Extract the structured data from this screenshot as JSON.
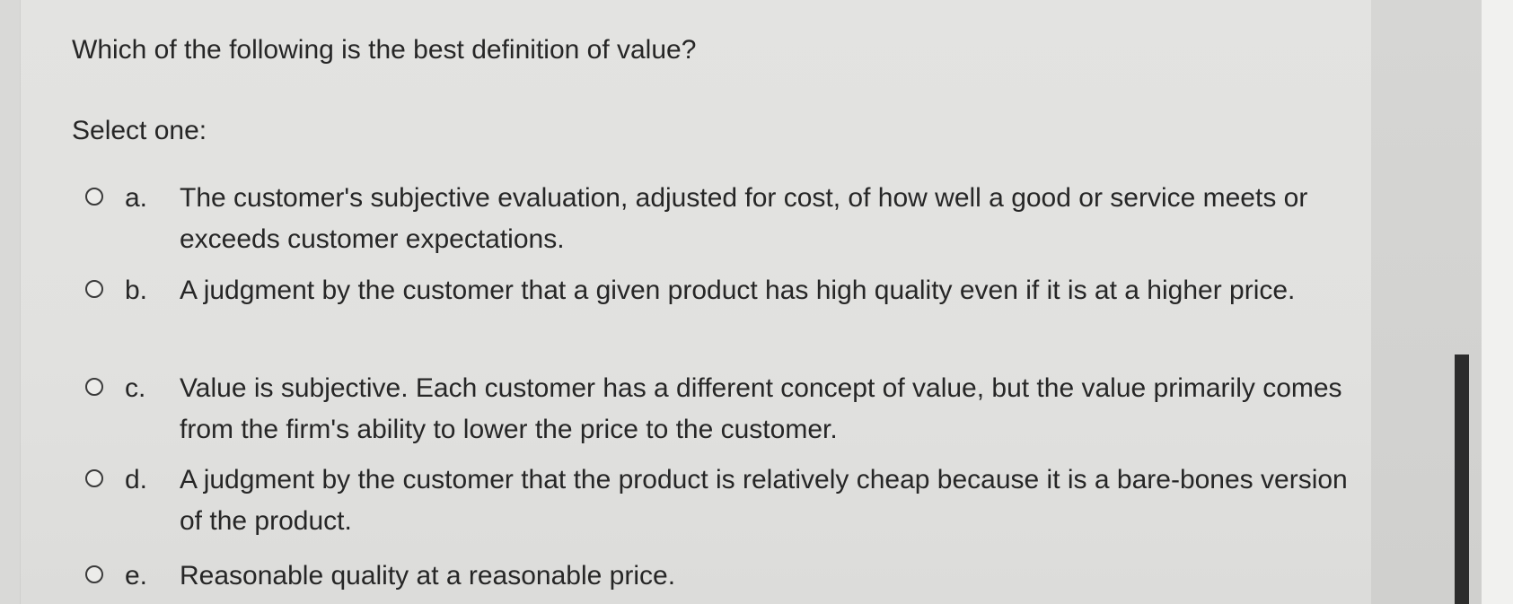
{
  "question": {
    "prompt": "Which of the following is the best definition of value?",
    "instruction": "Select one:"
  },
  "options": [
    {
      "letter": "a.",
      "text": "The customer's subjective evaluation, adjusted for cost, of how well a good or service meets or exceeds customer expectations.",
      "selected": false
    },
    {
      "letter": "b.",
      "text": "A judgment by the customer that a given product has high quality even if it is at a higher price.",
      "selected": false
    },
    {
      "letter": "c.",
      "text": "Value is subjective. Each customer has a different concept of value, but the value primarily comes from the firm's ability to lower the price to the customer.",
      "selected": false
    },
    {
      "letter": "d.",
      "text": "A judgment by the customer that the product is relatively cheap because it is a bare-bones version of the product.",
      "selected": false
    },
    {
      "letter": "e.",
      "text": "Reasonable quality at a reasonable price.",
      "selected": false
    }
  ],
  "icons": {
    "radio": "radio-unselected-icon"
  },
  "colors": {
    "text": "#262626",
    "background": "#e1e1df",
    "scrollbar_thumb": "#2c2c2c"
  }
}
